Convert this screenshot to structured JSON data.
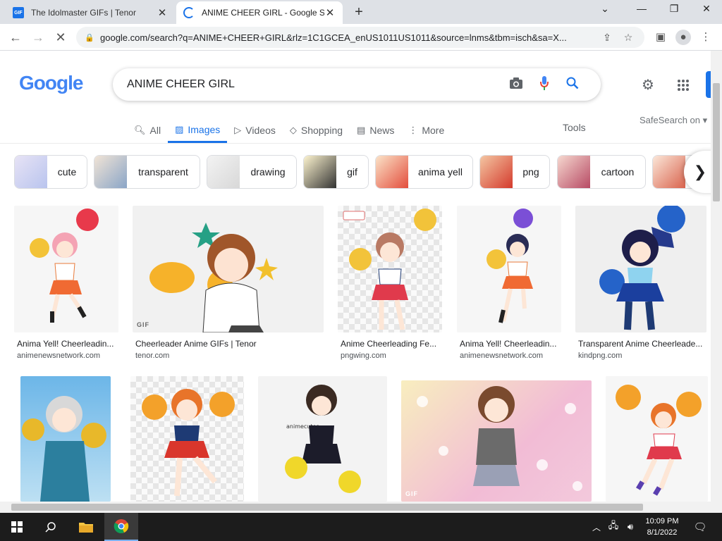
{
  "browser": {
    "tabs": [
      {
        "title": "The Idolmaster GIFs | Tenor",
        "favicon": "gif-icon",
        "active": false
      },
      {
        "title": "ANIME CHEER GIRL - Google Sea",
        "favicon": "loading-spinner-icon",
        "active": true
      }
    ],
    "url": "google.com/search?q=ANIME+CHEER+GIRL&rlz=1C1GCEA_enUS1011US1011&source=lnms&tbm=isch&sa=X..."
  },
  "search": {
    "logo": "Google",
    "query": "ANIME CHEER GIRL"
  },
  "nav": {
    "tabs": [
      "All",
      "Images",
      "Videos",
      "Shopping",
      "News",
      "More"
    ],
    "active": "Images",
    "tools": "Tools",
    "safesearch": "SafeSearch on"
  },
  "chips": [
    "cute",
    "transparent",
    "drawing",
    "gif",
    "anima yell",
    "png",
    "cartoon"
  ],
  "results": [
    {
      "caption": "Anima Yell! Cheerleadin...",
      "source": "animenewsnetwork.com"
    },
    {
      "caption": "Cheerleader Anime GIFs | Tenor",
      "source": "tenor.com",
      "badge": "GIF"
    },
    {
      "caption": "Anime Cheerleading Fe...",
      "source": "pngwing.com"
    },
    {
      "caption": "Anima Yell! Cheerleadin...",
      "source": "animenewsnetwork.com"
    },
    {
      "caption": "Transparent Anime Cheerleade...",
      "source": "kindpng.com"
    }
  ],
  "row2_badges": {
    "gif": "GIF",
    "watermark": "animecutes"
  },
  "taskbar": {
    "time": "10:09 PM",
    "date": "8/1/2022"
  },
  "colors": {
    "accent": "#1a73e8",
    "tabstrip": "#dee1e6",
    "taskbar": "#1c1c1c"
  }
}
